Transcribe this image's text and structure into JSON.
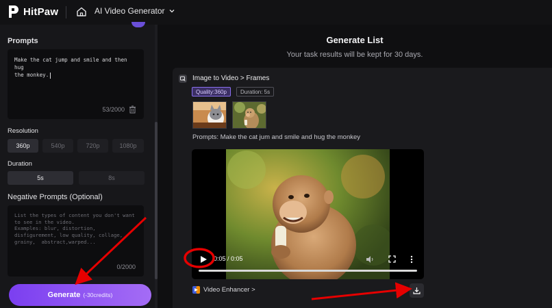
{
  "header": {
    "brand": "HitPaw",
    "product_menu": "AI Video Generator"
  },
  "left_panel": {
    "prompts_title": "Prompts",
    "prompt_value": "Make the cat jump and smile and then hug\nthe monkey.",
    "prompt_count": "53/2000",
    "resolution_title": "Resolution",
    "resolutions": [
      "360p",
      "540p",
      "720p",
      "1080p"
    ],
    "resolution_selected": "360p",
    "duration_title": "Duration",
    "durations": [
      "5s",
      "8s"
    ],
    "duration_selected": "5s",
    "negative_title": "Negative Prompts (Optional)",
    "negative_placeholder": "List the types of content you don't want\nto see in the video.\nExamples: blur, distortion,\ndisfigurement, low quality, collage,\ngrainy,  abstract,warped...",
    "negative_count": "0/2000",
    "generate_label": "Generate",
    "generate_credits": "(-30credits)"
  },
  "generate_list": {
    "title": "Generate List",
    "subtitle": "Your task results will be kept for 30 days."
  },
  "task": {
    "type": "Image to Video > Frames",
    "quality": "Quality:360p",
    "duration": "Duration: 5s",
    "prompt_line": "Prompts:  Make the cat jum and smile and hug the monkey",
    "player_time": "0:05 / 0:05",
    "enhancer_label": "Video Enhancer >"
  },
  "colors": {
    "accent": "#8b5cf6",
    "annotation": "#e60000"
  }
}
